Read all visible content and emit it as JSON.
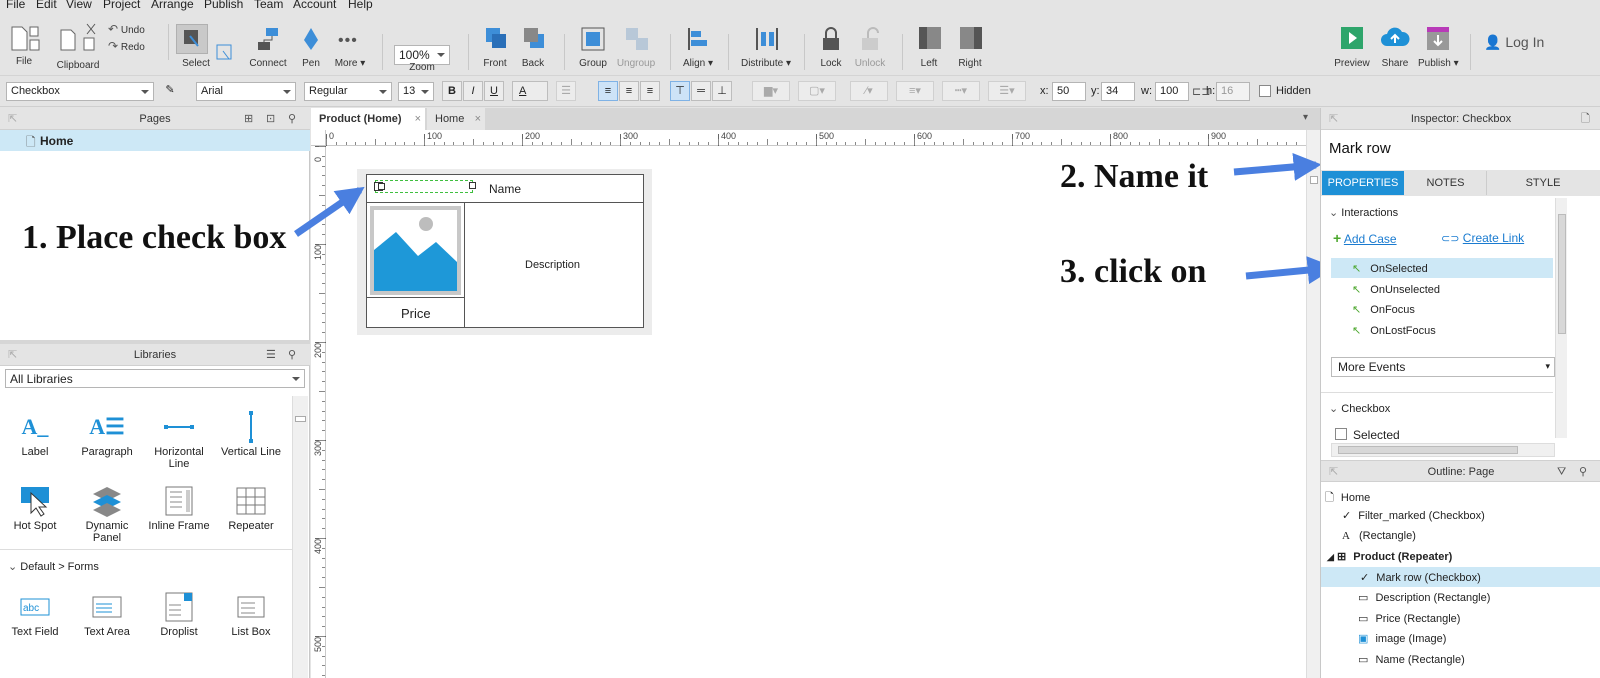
{
  "menu": [
    "File",
    "Edit",
    "View",
    "Project",
    "Arrange",
    "Publish",
    "Team",
    "Account",
    "Help"
  ],
  "toolbar": {
    "file": "File",
    "clipboard": "Clipboard",
    "undo": "Undo",
    "redo": "Redo",
    "select": "Select",
    "connect": "Connect",
    "pen": "Pen",
    "more": "More ▾",
    "zoom_value": "100%",
    "zoom": "Zoom",
    "front": "Front",
    "back": "Back",
    "group": "Group",
    "ungroup": "Ungroup",
    "align": "Align ▾",
    "distribute": "Distribute ▾",
    "lock": "Lock",
    "unlock": "Unlock",
    "left": "Left",
    "right": "Right",
    "preview": "Preview",
    "share": "Share",
    "publish": "Publish ▾",
    "login": "Log In"
  },
  "format": {
    "widget_type": "Checkbox",
    "font": "Arial",
    "weight": "Regular",
    "size": "13",
    "bold": "B",
    "italic": "I",
    "underline": "U",
    "font_color": "A",
    "x_label": "x:",
    "x": "50",
    "y_label": "y:",
    "y": "34",
    "w_label": "w:",
    "w": "100",
    "h_label": "h:",
    "h": "16",
    "hidden": "Hidden"
  },
  "pages": {
    "title": "Pages",
    "items": [
      "Home"
    ]
  },
  "libraries": {
    "title": "Libraries",
    "selected": "All Libraries",
    "items": [
      "Label",
      "Paragraph",
      "Horizontal Line",
      "Vertical Line",
      "Hot Spot",
      "Dynamic Panel",
      "Inline Frame",
      "Repeater"
    ],
    "forms_section": "Default > Forms",
    "forms": [
      "Text Field",
      "Text Area",
      "Droplist",
      "List Box"
    ]
  },
  "tabs": [
    "Product (Home)",
    "Home"
  ],
  "ruler_h": [
    "0",
    "100",
    "200",
    "300",
    "400",
    "500",
    "600",
    "700",
    "800",
    "900",
    "100"
  ],
  "ruler_v": [
    "0",
    "100",
    "200",
    "300",
    "400",
    "500"
  ],
  "canvas": {
    "name": "Name",
    "description": "Description",
    "price": "Price"
  },
  "annotations": {
    "step1": "1. Place check box",
    "step2": "2. Name it",
    "step3": "3. click on"
  },
  "inspector": {
    "title": "Inspector: Checkbox",
    "widget_name": "Mark row",
    "tabs": [
      "PROPERTIES",
      "NOTES",
      "STYLE"
    ],
    "interactions": "Interactions",
    "add_case": "Add Case",
    "create_link": "Create Link",
    "events": [
      "OnSelected",
      "OnUnselected",
      "OnFocus",
      "OnLostFocus"
    ],
    "more_events": "More Events",
    "checkbox_section": "Checkbox",
    "selected": "Selected"
  },
  "outline": {
    "title": "Outline: Page",
    "items": [
      "Home",
      "Filter_marked (Checkbox)",
      "(Rectangle)",
      "Product (Repeater)",
      "Mark row (Checkbox)",
      "Description (Rectangle)",
      "Price (Rectangle)",
      "image (Image)",
      "Name (Rectangle)"
    ]
  },
  "colors": {
    "accent": "#1e90d6",
    "arrow": "#4a7fe0",
    "selected_row": "#cde8f6",
    "green": "#4ca72e"
  }
}
